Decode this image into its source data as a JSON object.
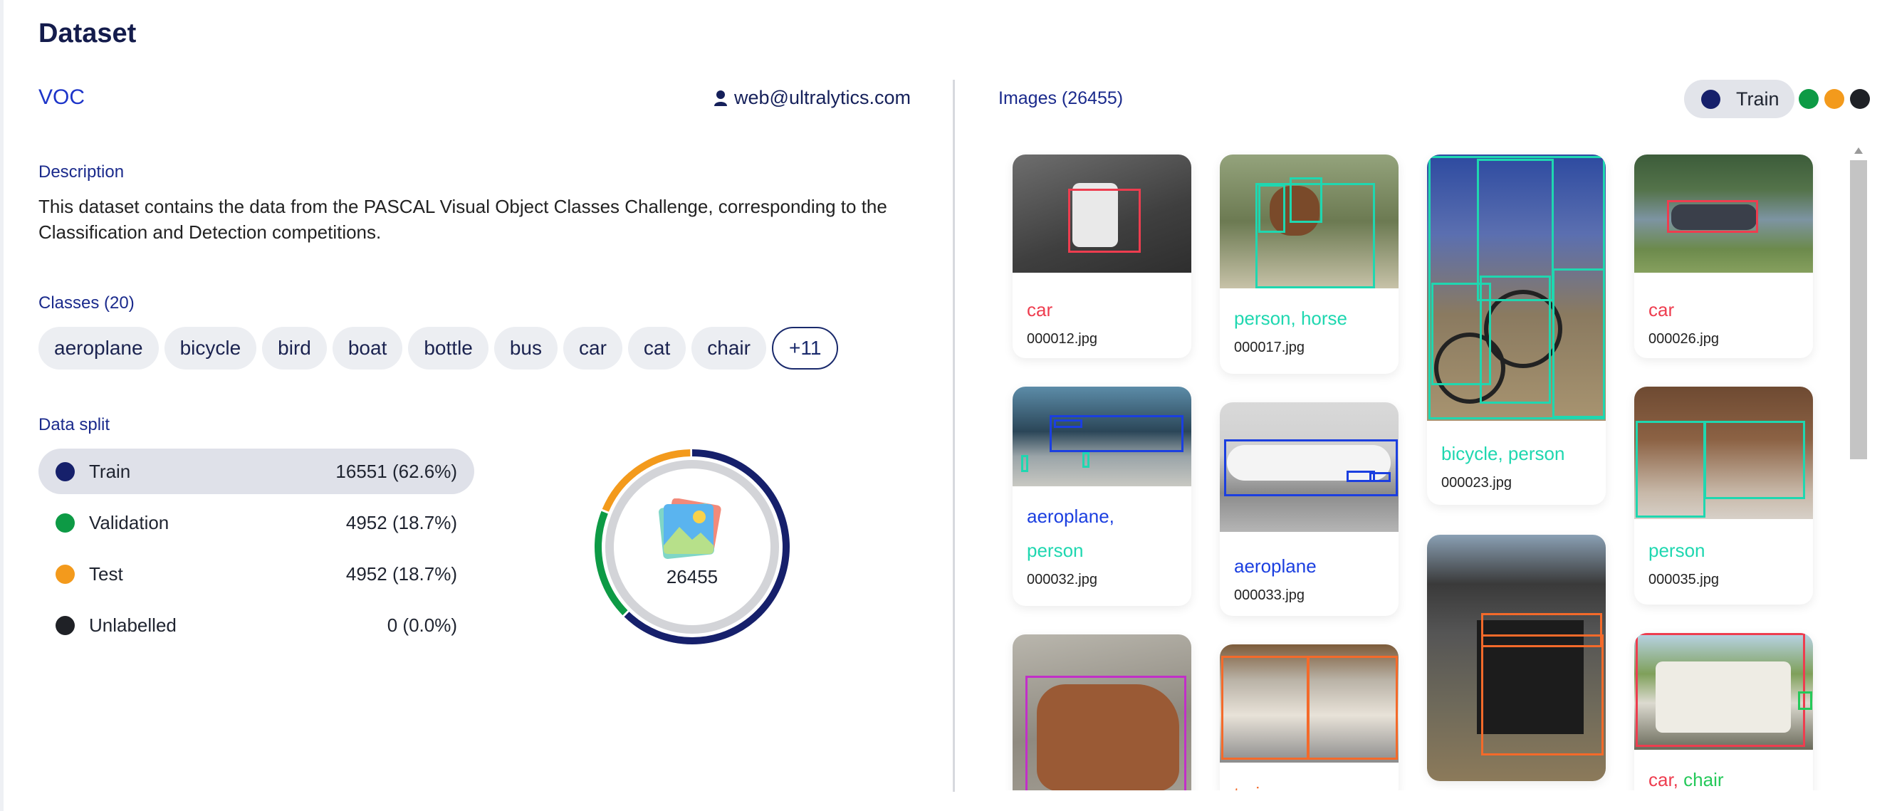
{
  "page": {
    "title": "Dataset"
  },
  "dataset": {
    "name": "VOC",
    "owner": "web@ultralytics.com",
    "description_label": "Description",
    "description": "This dataset contains the data from the PASCAL Visual Object Classes Challenge, corresponding to the Classification and Detection competitions.",
    "classes_label": "Classes (20)",
    "classes": [
      "aeroplane",
      "bicycle",
      "bird",
      "boat",
      "bottle",
      "bus",
      "car",
      "cat",
      "chair"
    ],
    "classes_more": "+11",
    "split_label": "Data split",
    "splits": [
      {
        "name": "Train",
        "count": "16551",
        "percent": "(62.6%)",
        "color": "#16206b",
        "fraction": 0.626
      },
      {
        "name": "Validation",
        "count": "4952",
        "percent": "(18.7%)",
        "color": "#0d9a45",
        "fraction": 0.187
      },
      {
        "name": "Test",
        "count": "4952",
        "percent": "(18.7%)",
        "color": "#f39a1c",
        "fraction": 0.187
      },
      {
        "name": "Unlabelled",
        "count": "0",
        "percent": "(0.0%)",
        "color": "#1f2126",
        "fraction": 0.0
      }
    ],
    "total_images": "26455"
  },
  "images_panel": {
    "count_label": "Images (26455)",
    "filter_label": "Train",
    "legend_colors": [
      "#0d9a45",
      "#f39a1c",
      "#1f2126"
    ],
    "cards": [
      {
        "labels": [
          {
            "text": "car",
            "color": "#ee3d4f"
          }
        ],
        "file": "000012.jpg"
      },
      {
        "labels": [
          {
            "text": "aeroplane,",
            "color": "#1b3fe0"
          },
          {
            "text": "person",
            "color": "#1fd7b0"
          }
        ],
        "file": "000032.jpg"
      },
      {
        "labels": [
          {
            "text": "person, horse",
            "color": "#1fd7b0"
          }
        ],
        "file": "000017.jpg"
      },
      {
        "labels": [
          {
            "text": "aeroplane",
            "color": "#1b3fe0"
          }
        ],
        "file": "000033.jpg"
      },
      {
        "labels": [
          {
            "text": "train",
            "color": "#f46a2a"
          }
        ],
        "file": ""
      },
      {
        "labels": [
          {
            "text": "bicycle, person",
            "color": "#1fd7b0"
          }
        ],
        "file": "000023.jpg"
      },
      {
        "labels": [
          {
            "text": "car",
            "color": "#ee3d4f"
          }
        ],
        "file": "000026.jpg"
      },
      {
        "labels": [
          {
            "text": "person",
            "color": "#1fd7b0"
          }
        ],
        "file": "000035.jpg"
      },
      {
        "labels": [
          {
            "text": "car,",
            "color": "#ee3d4f"
          },
          {
            "text": "chair",
            "color": "#25c95a"
          }
        ],
        "file": ""
      }
    ]
  }
}
